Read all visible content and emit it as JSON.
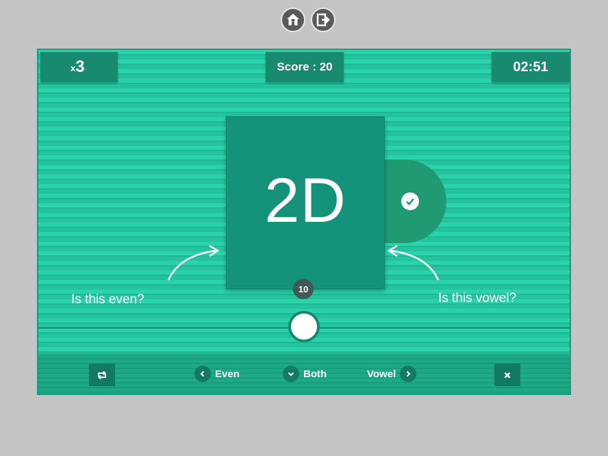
{
  "toolbar": {
    "home_icon": "home-icon",
    "exit_icon": "exit-icon"
  },
  "hud": {
    "multiplier_prefix": "x",
    "multiplier_value": "3",
    "score_label": "Score : 20",
    "timer": "02:51"
  },
  "card": {
    "text": "2D",
    "counter": "10"
  },
  "hints": {
    "left": "Is this even?",
    "right": "Is this vowel?"
  },
  "controls": {
    "even_label": "Even",
    "both_label": "Both",
    "vowel_label": "Vowel"
  },
  "colors": {
    "accent": "#24c79f",
    "dark": "#178a70",
    "card": "#14937a"
  }
}
